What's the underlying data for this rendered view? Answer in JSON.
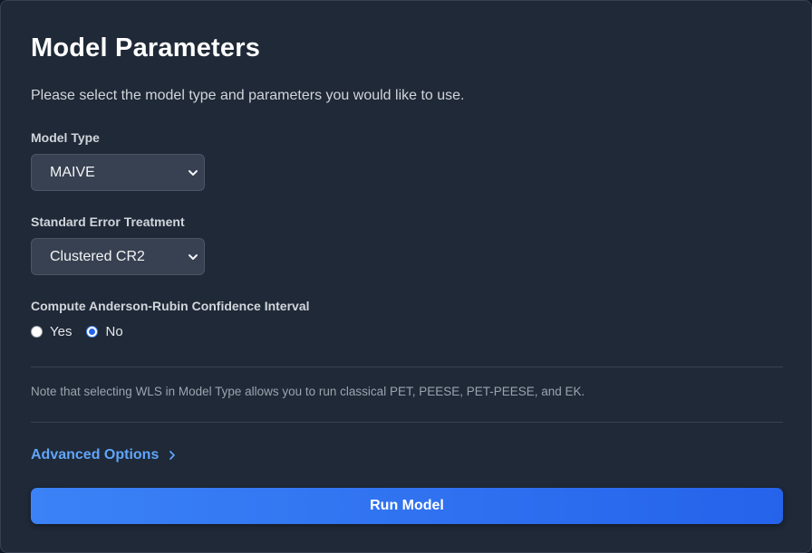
{
  "header": {
    "title": "Model Parameters",
    "subtitle": "Please select the model type and parameters you would like to use."
  },
  "model_type": {
    "label": "Model Type",
    "selected": "MAIVE"
  },
  "se_treatment": {
    "label": "Standard Error Treatment",
    "selected": "Clustered CR2"
  },
  "anderson_rubin": {
    "label": "Compute Anderson-Rubin Confidence Interval",
    "options": [
      "Yes",
      "No"
    ],
    "selected": "No"
  },
  "note": "Note that selecting WLS in Model Type allows you to run classical PET, PEESE, PET-PEESE, and EK.",
  "advanced": {
    "label": "Advanced Options",
    "icon": "chevron-right-icon"
  },
  "run_button": {
    "label": "Run Model"
  },
  "colors": {
    "background": "#1f2937",
    "accent": "#3b82f6",
    "link": "#60a5fa"
  }
}
